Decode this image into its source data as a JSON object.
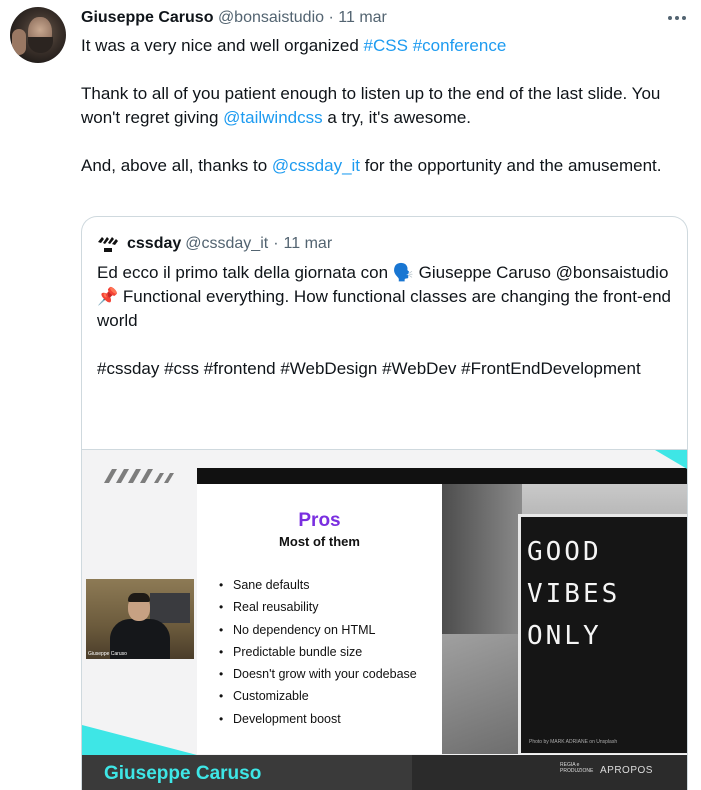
{
  "tweet": {
    "author_name": "Giuseppe Caruso",
    "author_handle": "@bonsaistudio",
    "separator": "·",
    "date": "11 mar",
    "line1_text": "It was a very nice and well organized ",
    "hashtag_css": "#CSS",
    "hashtag_conference": "#conference",
    "line2_a": "Thank to all of you patient enough to listen up to the end of the last slide. You won't regret giving ",
    "mention_tailwind": "@tailwindcss",
    "line2_b": " a try, it's awesome.",
    "line3_a": "And, above all, thanks to ",
    "mention_cssday": "@cssday_it",
    "line3_b": " for the opportunity and the amusement."
  },
  "quote": {
    "name": "cssday",
    "handle": "@cssday_it",
    "separator": "·",
    "date": "11 mar",
    "line1": "Ed ecco il primo talk della giornata con 🗣️ Giuseppe Caruso @bonsaistudio",
    "line2": "📌 Functional everything. How functional classes are changing the front-end world",
    "hashtags": "#cssday #css #frontend #WebDesign #WebDev #FrontEndDevelopment"
  },
  "slide": {
    "title": "Pros",
    "subtitle": "Most of them",
    "items": [
      "Sane defaults",
      "Real reusability",
      "No dependency on HTML",
      "Predictable bundle size",
      "Doesn't grow with your codebase",
      "Customizable",
      "Development boost"
    ],
    "board_lines": [
      "GOOD",
      "VIBES",
      "ONLY"
    ],
    "photo_credit": "Photo by MARK ADRIANE on Unsplash",
    "webcam_label": "Giuseppe Caruso",
    "speaker_name": "Giuseppe Caruso",
    "sponsor_small": "REGIA e PRODUZIONE",
    "sponsor_brand": "APROPOS"
  },
  "colors": {
    "link": "#1d9bf0",
    "slide_title": "#7a2fe0",
    "accent_cyan": "#3ee6e6"
  }
}
